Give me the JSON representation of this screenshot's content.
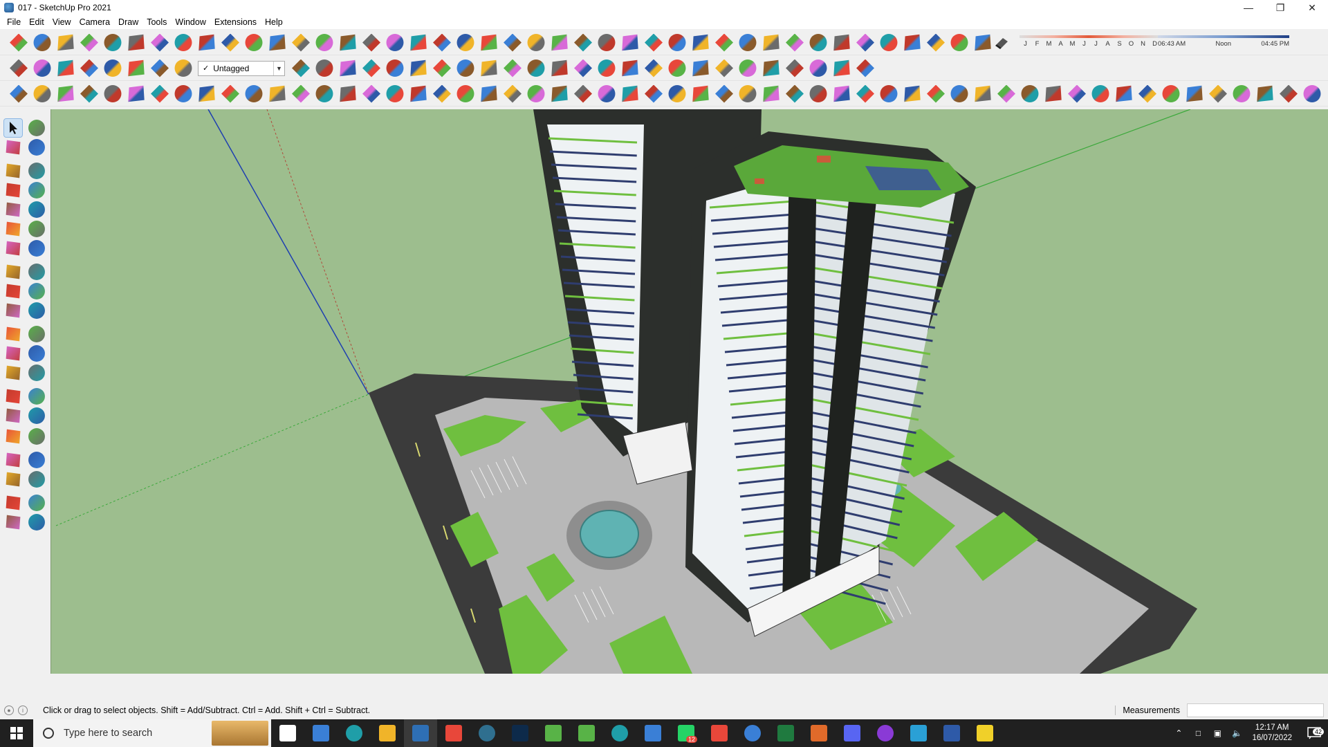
{
  "window": {
    "title": "017 - SketchUp Pro 2021",
    "controls": [
      "minimize",
      "restore",
      "close"
    ]
  },
  "menu": [
    "File",
    "Edit",
    "View",
    "Camera",
    "Draw",
    "Tools",
    "Window",
    "Extensions",
    "Help"
  ],
  "tag_dropdown": {
    "value": "Untagged"
  },
  "shadows": {
    "months": [
      "J",
      "F",
      "M",
      "A",
      "M",
      "J",
      "J",
      "A",
      "S",
      "O",
      "N",
      "D"
    ],
    "time_start": "06:43 AM",
    "time_mid": "Noon",
    "time_end": "04:45 PM"
  },
  "status": {
    "message": "Click or drag to select objects. Shift = Add/Subtract. Ctrl = Add. Shift + Ctrl = Subtract.",
    "measurements_label": "Measurements",
    "measurements_value": ""
  },
  "taskbar": {
    "search_placeholder": "Type here to search",
    "time": "12:17 AM",
    "date": "16/07/2022",
    "whatsapp_badge": "12",
    "notification_count": "42"
  },
  "colors": {
    "viewport_ground": "#9dbe8e",
    "road": "#3b3b3b",
    "grass": "#6fbf3f",
    "paving": "#b8b8b8",
    "tower_glass": "#eef2f4",
    "tower_frame": "#2c2f2c",
    "pool": "#5fb3b3"
  }
}
